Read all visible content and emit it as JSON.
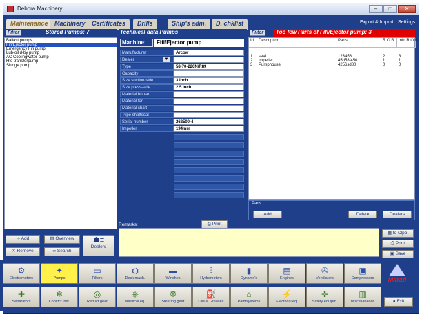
{
  "window": {
    "title": "Debora Machinery",
    "controls": [
      "–",
      "□",
      "✕"
    ]
  },
  "menu": {
    "tabs": [
      "Maintenance",
      "Machinery",
      "Certificates",
      "Drills",
      "Ship's adm.",
      "D. chklist"
    ],
    "active_tab": "Maintenance",
    "right_links": [
      "Export & Import",
      "Settings"
    ]
  },
  "left_panel": {
    "filter_label": "Filter",
    "title": "Stored Pumps:  7",
    "items": [
      "Ballast pumps",
      "Fifi/Ejector pump",
      "Emergency Fifi pump",
      "Lub-oil d-by pump",
      "AC Coolingwater pump",
      "Hfo transferpump",
      "Sludge pump"
    ],
    "selected_index": 1
  },
  "tech": {
    "title": "Technical data Pumps",
    "machine_label": "Machine:",
    "machine_value": "Fifi/Ejector pump",
    "fields": [
      {
        "label": "Manufacturer",
        "value": "Arcow"
      },
      {
        "label": "Dealer",
        "value": ""
      },
      {
        "label": "Type",
        "value": "58-70-220N/R89"
      },
      {
        "label": "Capacity",
        "value": ""
      },
      {
        "label": "Size suction-side",
        "value": "3 inch"
      },
      {
        "label": "Size press-side",
        "value": "2.5 inch"
      },
      {
        "label": "Material house",
        "value": ""
      },
      {
        "label": "Material fan",
        "value": ""
      },
      {
        "label": "Material shaft",
        "value": ""
      },
      {
        "label": "Type shaftseal",
        "value": ""
      },
      {
        "label": "Serial number",
        "value": "262500-4"
      },
      {
        "label": "Impeller",
        "value": "194mm"
      }
    ],
    "print_label": "Print"
  },
  "parts": {
    "filter_label": "Filter",
    "alert": "Too few Parts of Fifi/Ejector pump: 3",
    "columns": [
      "Id",
      "Description",
      "Parts",
      "R.O.B.",
      "min.R.O.B."
    ],
    "rows": [
      {
        "id": "1",
        "description": "seal",
        "parts": "123456",
        "rob": "2",
        "min": "3"
      },
      {
        "id": "2",
        "description": "impeller",
        "parts": "45d58f450",
        "rob": "1",
        "min": "1"
      },
      {
        "id": "3",
        "description": "Pumphouse",
        "parts": "4256sd80",
        "rob": "0",
        "min": "0"
      }
    ],
    "group_label": "Parts",
    "add_label": "Add",
    "delete_label": "Delete",
    "dealers_label": "Dealers"
  },
  "left_buttons": {
    "add": "Add",
    "overview": "Overview",
    "remove": "Remove",
    "search": "Search",
    "dealers": "Dealers"
  },
  "remarks": {
    "label": "Remarks:",
    "value": ""
  },
  "right_buttons": {
    "clipboard": "to Clpb.",
    "print": "Print",
    "save": "Save"
  },
  "categories_row1": [
    "Electromotors",
    "Pumps",
    "Filters",
    "Deck mach.",
    "Winches",
    "Hydromotors",
    "Dynamo's",
    "Engines",
    "Ventilators",
    "Compressors"
  ],
  "categories_row2": [
    "Separators",
    "Cool/frz inst.",
    "Reduct gear",
    "Nautical eq.",
    "Steering gear",
    "Oils & Greases",
    "Paintsystems",
    "Electrical eq.",
    "Safety equipm.",
    "Miscellaneous"
  ],
  "active_category": "Pumps",
  "logo_text": "Marad",
  "exit_label": "Exit",
  "colors": {
    "frame": "#1f3f8a",
    "alert": "#e00000",
    "selected": "#2450c0",
    "active_category": "#fff04a",
    "remarks_bg": "#ffffc8"
  }
}
